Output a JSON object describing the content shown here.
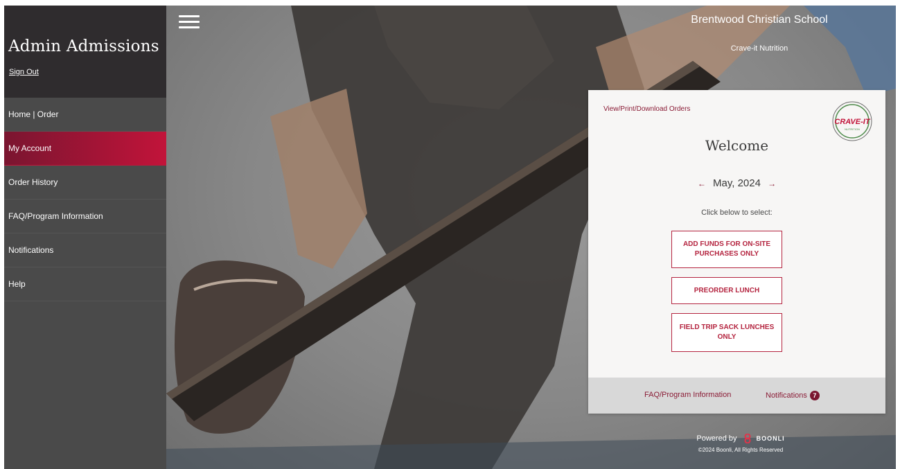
{
  "sidebar": {
    "user_name": "Admin Admissions",
    "sign_out": "Sign Out",
    "items": [
      {
        "label": "Home | Order"
      },
      {
        "label": "My Account",
        "active": true
      },
      {
        "label": "Order History"
      },
      {
        "label": "FAQ/Program Information"
      },
      {
        "label": "Notifications"
      },
      {
        "label": "Help"
      }
    ]
  },
  "header": {
    "school_name": "Brentwood Christian School",
    "vendor_name": "Crave-it Nutrition",
    "menu_icon": "hamburger-icon"
  },
  "card": {
    "view_orders_link": "View/Print/Download Orders",
    "logo_text": "CRAVE-IT",
    "logo_subtext": "NUTRITION",
    "welcome": "Welcome",
    "month": "May, 2024",
    "prev_arrow": "←",
    "next_arrow": "→",
    "select_prompt": "Click below to select:",
    "buttons": [
      {
        "label": "ADD FUNDS FOR ON-SITE PURCHASES ONLY"
      },
      {
        "label": "PREORDER LUNCH"
      },
      {
        "label": "FIELD TRIP SACK LUNCHES ONLY"
      }
    ],
    "footer": {
      "faq_link": "FAQ/Program Information",
      "notifications_link": "Notifications",
      "notifications_count": "7"
    }
  },
  "powered": {
    "label": "Powered by",
    "brand": "BOONLI",
    "copyright": "©2024 Boonli, All Rights Reserved"
  },
  "colors": {
    "accent": "#b4243f",
    "active_nav": "#c2143a",
    "sidebar_bg": "#4a4a4a",
    "sidebar_header_bg": "#2f2c2e"
  }
}
